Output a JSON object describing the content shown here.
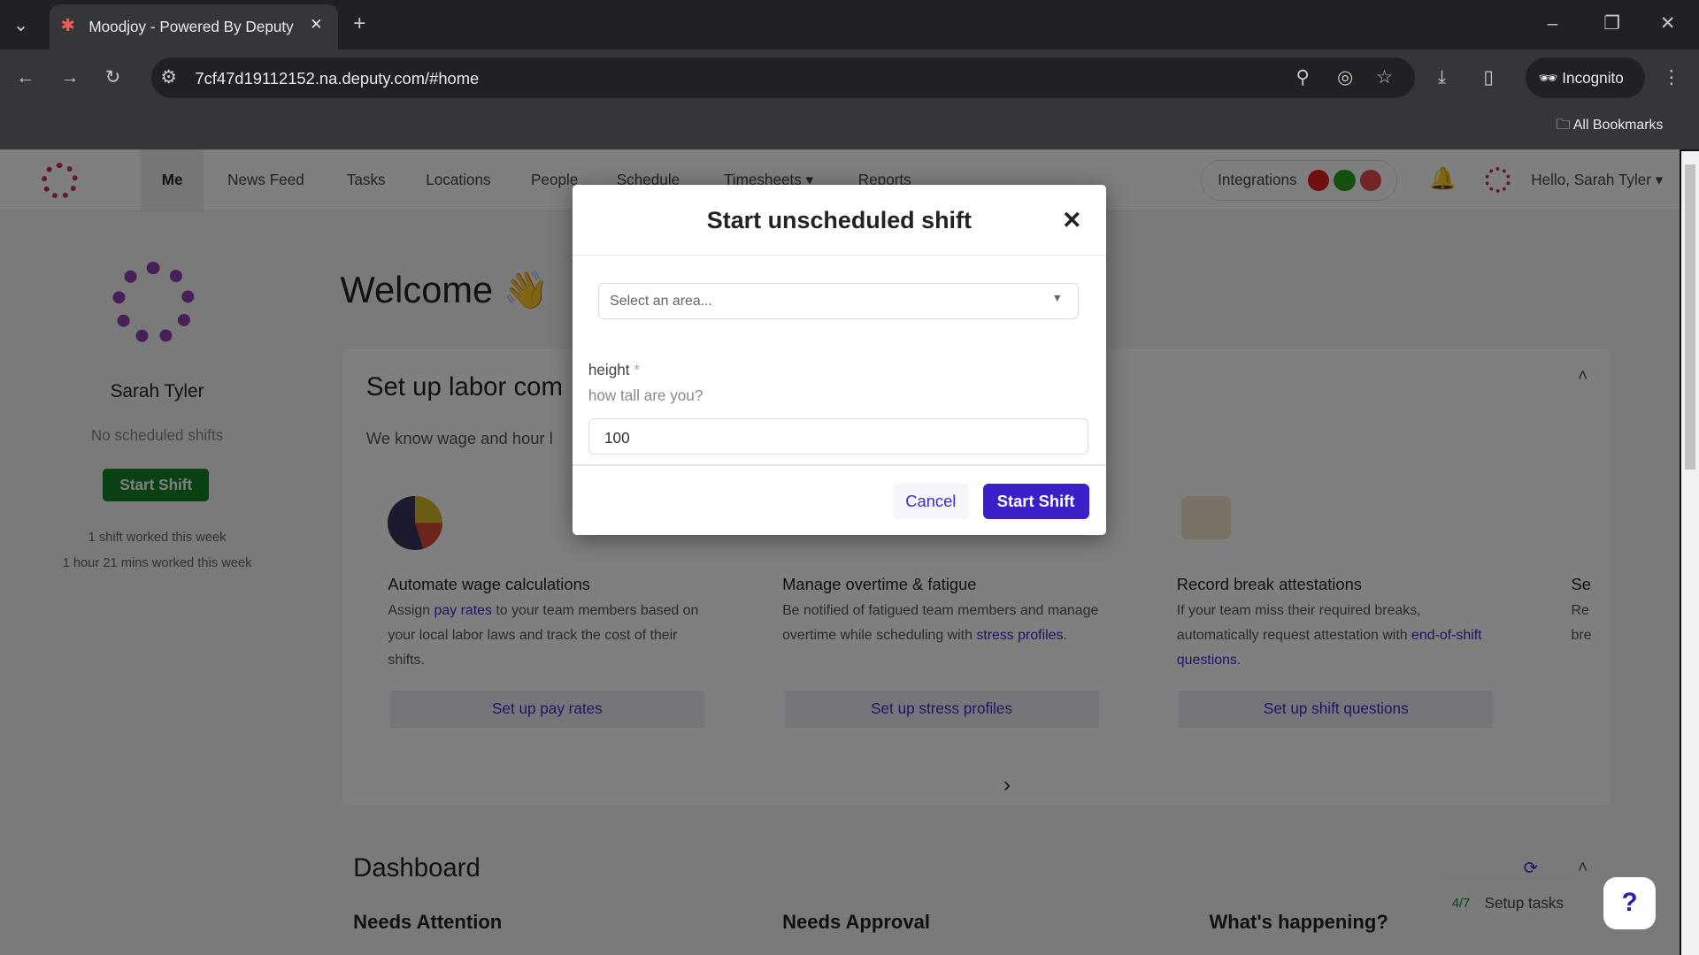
{
  "browser": {
    "tab_title": "Moodjoy - Powered By Deputy",
    "url": "7cf47d19112152.na.deputy.com/#home",
    "incognito": "Incognito",
    "bookmarks": "All Bookmarks"
  },
  "nav": {
    "items": [
      "Me",
      "News Feed",
      "Tasks",
      "Locations",
      "People",
      "Schedule",
      "Timesheets ▾",
      "Reports"
    ],
    "integrations": "Integrations",
    "greeting": "Hello, Sarah Tyler ▾"
  },
  "profile": {
    "name": "Sarah Tyler",
    "no_shifts": "No scheduled shifts",
    "start_shift": "Start Shift",
    "stat1": "1 shift worked this week",
    "stat2": "1 hour 21 mins worked this week"
  },
  "main": {
    "welcome": "Welcome 👋",
    "section_title": "Set up labor com",
    "section_desc": "We know wage and hour l",
    "cards": [
      {
        "title": "Automate wage calculations",
        "d1": "Assign ",
        "link": "pay rates",
        "d2": " to your team members based on your local labor laws and track the cost of their shifts.",
        "button": "Set up pay rates"
      },
      {
        "title": "Manage overtime & fatigue",
        "d1": "Be notified of fatigued team members and manage overtime while scheduling with ",
        "link": "stress profiles",
        "d2": ".",
        "button": "Set up stress profiles"
      },
      {
        "title": "Record break attestations",
        "d1": "If your team miss their required breaks, automatically request attestation with ",
        "link": "end-of-shift questions",
        "d2": ".",
        "button": "Set up shift questions"
      },
      {
        "title": "Se",
        "d1": "Re bre",
        "link": "",
        "d2": "",
        "button": ""
      }
    ],
    "dashboard": "Dashboard",
    "col1": "Needs Attention",
    "col2": "Needs Approval",
    "col3": "What's happening?",
    "setup_count": "4/7",
    "setup_label": "Setup tasks",
    "help": "?"
  },
  "modal": {
    "title": "Start unscheduled shift",
    "select_placeholder": "Select an area...",
    "field_label": "height",
    "required": "*",
    "field_help": "how tall are you?",
    "field_value": "100",
    "cancel": "Cancel",
    "submit": "Start Shift"
  },
  "colors": {
    "primary": "#3b1fc8",
    "green": "#13832a"
  }
}
